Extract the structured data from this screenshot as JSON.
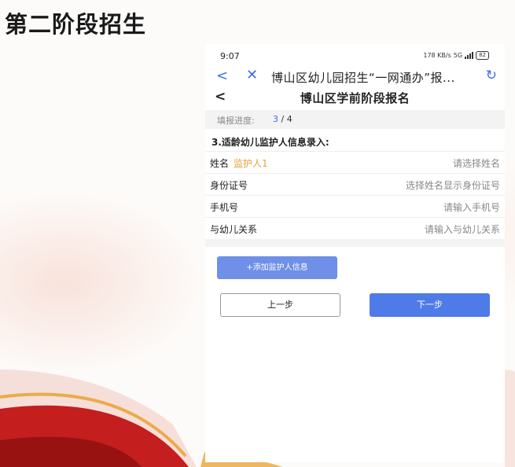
{
  "slide_title": "第二阶段招生",
  "status_bar": {
    "time": "9:07",
    "net_speed": "178 KB/s",
    "signal": "5G",
    "battery": "82"
  },
  "browser": {
    "back_icon": "<",
    "close_icon": "✕",
    "title": "博山区幼儿园招生“一网通办”报...",
    "refresh_icon": "↻"
  },
  "page": {
    "back_icon": "<",
    "title": "博山区学前阶段报名"
  },
  "progress": {
    "label": "填报进度:",
    "current": "3",
    "separator": " / ",
    "total": "4",
    "fraction": 0.75
  },
  "section_title": "3.适龄幼儿监护人信息录入:",
  "form_rows": [
    {
      "label": "姓名",
      "tag": "监护人1",
      "value": "请选择姓名"
    },
    {
      "label": "身份证号",
      "value": "选择姓名显示身份证号"
    },
    {
      "label": "手机号",
      "value": "请输入手机号"
    },
    {
      "label": "与幼儿关系",
      "value": "请输入与幼儿关系"
    }
  ],
  "add_button": "+添加监护人信息",
  "prev_button": "上一步",
  "next_button": "下一步",
  "colors": {
    "accent": "#3a6ee8",
    "tag": "#e8a23a",
    "add_button": "#6f8fe8",
    "next_button": "#4f7be8",
    "wave_red": "#c41e1e",
    "wave_gold": "#e9a53a"
  }
}
